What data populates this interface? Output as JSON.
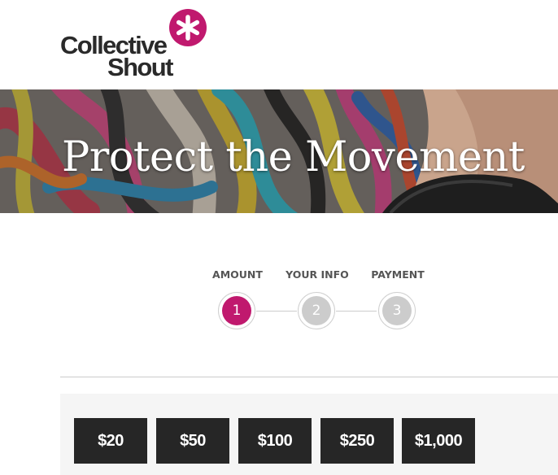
{
  "brand": {
    "line1": "Collective",
    "line2": "Shout",
    "accent": "#c0196e"
  },
  "hero": {
    "title": "Protect the Movement"
  },
  "steps": [
    {
      "label": "AMOUNT",
      "number": "1",
      "active": true
    },
    {
      "label": "YOUR INFO",
      "number": "2",
      "active": false
    },
    {
      "label": "PAYMENT",
      "number": "3",
      "active": false
    }
  ],
  "amounts": [
    "$20",
    "$50",
    "$100",
    "$250",
    "$1,000"
  ],
  "colors": {
    "active_step": "#c0196e",
    "inactive_step": "#cccccc",
    "amount_button": "#262626"
  }
}
